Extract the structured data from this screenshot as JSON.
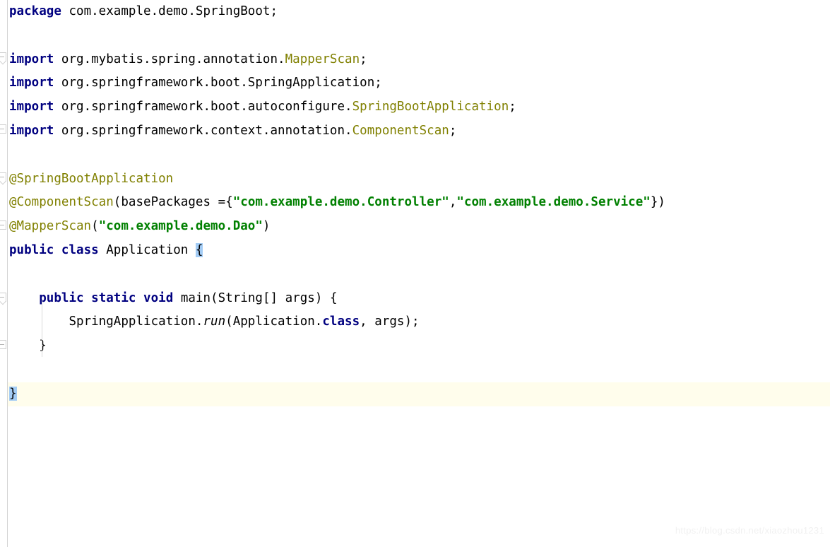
{
  "editor": {
    "language": "java",
    "file_kind": "Java source file",
    "background_color": "#ffffff",
    "current_line_color": "#fffdec",
    "bracket_match_color": "#a3ccf5",
    "keyword_color": "#000080",
    "annotation_color": "#808000",
    "string_color": "#008000",
    "plain_color": "#000000",
    "gutter_separator_color": "#d4d4d4",
    "indent_guide_color": "#d9d9d9"
  },
  "code": {
    "line01": "package com.example.demo.SpringBoot;",
    "line02": "",
    "line03": "import org.mybatis.spring.annotation.MapperScan;",
    "line04": "import org.springframework.boot.SpringApplication;",
    "line05": "import org.springframework.boot.autoconfigure.SpringBootApplication;",
    "line06": "import org.springframework.context.annotation.ComponentScan;",
    "line07": "",
    "line08": "@SpringBootApplication",
    "line09": "@ComponentScan(basePackages ={\"com.example.demo.Controller\",\"com.example.demo.Service\"})",
    "line10": "@MapperScan(\"com.example.demo.Dao\")",
    "line11": "public class Application {",
    "line12": "",
    "line13": "    public static void main(String[] args) {",
    "line14": "        SpringApplication.run(Application.class, args);",
    "line15": "    }",
    "line16": "",
    "line17": "}"
  },
  "tokens": {
    "kw_package": "package",
    "kw_import": "import",
    "kw_public": "public",
    "kw_class": "class",
    "kw_static": "static",
    "kw_void": "void",
    "kw_class_literal": "class",
    "pkg_name": " com.example.demo.SpringBoot;",
    "imp1_path": " org.mybatis.spring.annotation.",
    "imp1_type": "MapperScan",
    "imp1_semi": ";",
    "imp2_path": " org.springframework.boot.SpringApplication;",
    "imp3_path": " org.springframework.boot.autoconfigure.",
    "imp3_type": "SpringBootApplication",
    "imp3_semi": ";",
    "imp4_path": " org.springframework.context.annotation.",
    "imp4_type": "ComponentScan",
    "imp4_semi": ";",
    "anno1": "@SpringBootApplication",
    "anno2_name": "@ComponentScan",
    "anno2_open": "(basePackages ={",
    "anno2_str1": "\"com.example.demo.Controller\"",
    "anno2_comma": ",",
    "anno2_str2": "\"com.example.demo.Service\"",
    "anno2_close": "})",
    "anno3_name": "@MapperScan",
    "anno3_open": "(",
    "anno3_str": "\"com.example.demo.Dao\"",
    "anno3_close": ")",
    "cls_name": " Application ",
    "cls_brace": "{",
    "main_indent": "    ",
    "main_sig": " main(String[] args) {",
    "body_indent": "        ",
    "body_receiver": "SpringApplication.",
    "body_method": "run",
    "body_args_a": "(Application.",
    "body_args_b": ", args);",
    "close_inner_indent": "    ",
    "close_inner": "}",
    "close_outer": "}"
  },
  "gutter": {
    "fold_marker_label": "collapse-fold",
    "markers_on_lines": [
      3,
      6,
      8,
      10,
      13,
      15
    ]
  },
  "watermark": {
    "text": "https://blog.csdn.net/xiaozhou1231"
  }
}
